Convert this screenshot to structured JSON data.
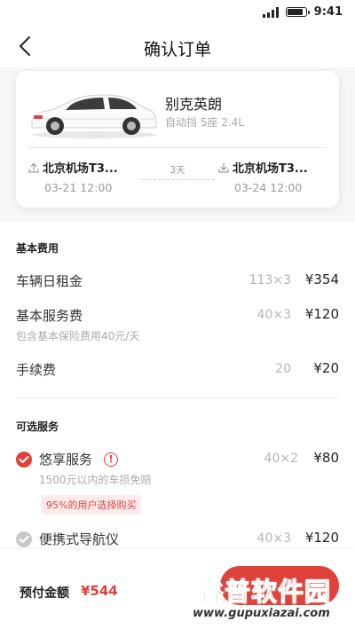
{
  "status_bar": {
    "time": "9:41",
    "signal_bars": 4,
    "battery_level": 0.85
  },
  "nav": {
    "title": "确认订单",
    "back_icon": "chevron-left-icon"
  },
  "car": {
    "name": "别克英朗",
    "spec": "自动挡 5座 2.4L",
    "pickup": {
      "location": "北京机场T3...",
      "time": "03-21 12:00",
      "icon": "pickup-upload-icon"
    },
    "return": {
      "location": "北京机场T3...",
      "time": "03-24 12:00",
      "icon": "return-download-icon"
    },
    "days": "3天"
  },
  "basic_fees": {
    "title": "基本费用",
    "rows": [
      {
        "label": "车辆日租金",
        "calc": "113×3",
        "amount": "¥354"
      },
      {
        "label": "基本服务费",
        "sub": "包含基本保险费用40元/天",
        "calc": "40×3",
        "amount": "¥120"
      },
      {
        "label": "手续费",
        "calc": "20",
        "amount": "¥20"
      }
    ]
  },
  "optional_services": {
    "title": "可选服务",
    "items": [
      {
        "label": "悠享服务",
        "sub": "1500元以内的车损免赔",
        "badge": "95%的用户选择购买",
        "calc": "40×2",
        "amount": "¥80",
        "checked": true,
        "info_icon": "!"
      },
      {
        "label": "便携式导航仪",
        "calc": "40×3",
        "amount": "¥120",
        "checked": false
      }
    ]
  },
  "footer": {
    "prepay_label": "预付金额",
    "prepay_amount": "¥544"
  },
  "watermark": {
    "title": "谷普软件园",
    "url": "www.gupuxiazai.com"
  },
  "colors": {
    "accent": "#e0413b",
    "watermark_green": "#4da935"
  }
}
